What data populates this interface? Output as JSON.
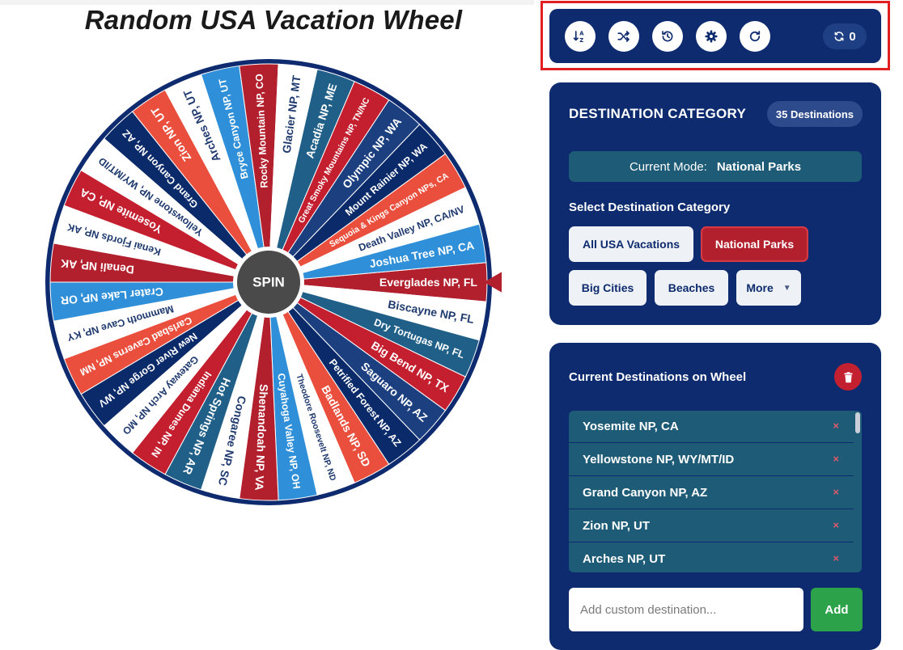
{
  "page": {
    "title": "Random USA Vacation Wheel"
  },
  "wheel": {
    "spin_label": "SPIN",
    "segments": [
      {
        "label": "Everglades NP, FL",
        "color": "#b3202d"
      },
      {
        "label": "Biscayne NP, FL",
        "color": "#ffffff"
      },
      {
        "label": "Dry Tortugas NP, FL",
        "color": "#1f5f88"
      },
      {
        "label": "Big Bend NP, TX",
        "color": "#c41f2f"
      },
      {
        "label": "Saguaro NP, AZ",
        "color": "#1c3f80"
      },
      {
        "label": "Petrified Forest NP, AZ",
        "color": "#0b2a6a"
      },
      {
        "label": "Badlands NP, SD",
        "color": "#ea4f3d"
      },
      {
        "label": "Theodore Roosevelt NP, ND",
        "color": "#ffffff"
      },
      {
        "label": "Cuyahoga Valley NP, OH",
        "color": "#2f8fd8"
      },
      {
        "label": "Shenandoah NP, VA",
        "color": "#b3202d"
      },
      {
        "label": "Congaree NP, SC",
        "color": "#ffffff"
      },
      {
        "label": "Hot Springs NP, AR",
        "color": "#1f5f88"
      },
      {
        "label": "Indiana Dunes NP, IN",
        "color": "#c41f2f"
      },
      {
        "label": "Gateway Arch NP, MO",
        "color": "#ffffff"
      },
      {
        "label": "New River Gorge NP, WV",
        "color": "#0b2a6a"
      },
      {
        "label": "Carlsbad Caverns NP, NM",
        "color": "#ea4f3d"
      },
      {
        "label": "Mammoth Cave NP, KY",
        "color": "#ffffff"
      },
      {
        "label": "Crater Lake NP, OR",
        "color": "#2f8fd8"
      },
      {
        "label": "Denali NP, AK",
        "color": "#b3202d"
      },
      {
        "label": "Kenai Fjords NP, AK",
        "color": "#ffffff"
      },
      {
        "label": "Yosemite NP, CA",
        "color": "#c41f2f"
      },
      {
        "label": "Yellowstone NP, WY/MT/ID",
        "color": "#ffffff"
      },
      {
        "label": "Grand Canyon NP, AZ",
        "color": "#0b2a6a"
      },
      {
        "label": "Zion NP, UT",
        "color": "#ea4f3d"
      },
      {
        "label": "Arches NP, UT",
        "color": "#ffffff"
      },
      {
        "label": "Bryce Canyon NP, UT",
        "color": "#2f8fd8"
      },
      {
        "label": "Rocky Mountain NP, CO",
        "color": "#b3202d"
      },
      {
        "label": "Glacier NP, MT",
        "color": "#ffffff"
      },
      {
        "label": "Acadia NP, ME",
        "color": "#1f5f88"
      },
      {
        "label": "Great Smoky Mountains NP, TN/NC",
        "color": "#c41f2f"
      },
      {
        "label": "Olympic NP, WA",
        "color": "#1c3f80"
      },
      {
        "label": "Mount Rainier NP, WA",
        "color": "#0b2a6a"
      },
      {
        "label": "Sequoia & Kings Canyon NPs, CA",
        "color": "#ea4f3d"
      },
      {
        "label": "Death Valley NP, CA/NV",
        "color": "#ffffff"
      },
      {
        "label": "Joshua Tree NP, CA",
        "color": "#2f8fd8"
      }
    ]
  },
  "toolbar": {
    "buttons": [
      {
        "icon": "sort-az-icon"
      },
      {
        "icon": "shuffle-icon"
      },
      {
        "icon": "history-icon"
      },
      {
        "icon": "gear-icon"
      },
      {
        "icon": "redo-icon"
      }
    ],
    "spin_count": "0"
  },
  "category_panel": {
    "heading": "DESTINATION CATEGORY",
    "count_badge": "35 Destinations",
    "mode_label": "Current Mode:",
    "mode_value": "National Parks",
    "select_label": "Select Destination Category",
    "buttons": {
      "all_usa": "All USA Vacations",
      "national_parks": "National Parks",
      "big_cities": "Big Cities",
      "beaches": "Beaches",
      "more": "More",
      "more_caret": "▼"
    }
  },
  "destinations_panel": {
    "heading": "Current Destinations on Wheel",
    "remove_glyph": "×",
    "items": [
      "Yosemite NP, CA",
      "Yellowstone NP, WY/MT/ID",
      "Grand Canyon NP, AZ",
      "Zion NP, UT",
      "Arches NP, UT"
    ],
    "input_placeholder": "Add custom destination...",
    "add_label": "Add"
  },
  "colors": {
    "navy": "#0d2b6e",
    "teal": "#1d5b77",
    "accent_red": "#b3202d",
    "add_green": "#2ca24a",
    "highlight": "#e02020"
  }
}
